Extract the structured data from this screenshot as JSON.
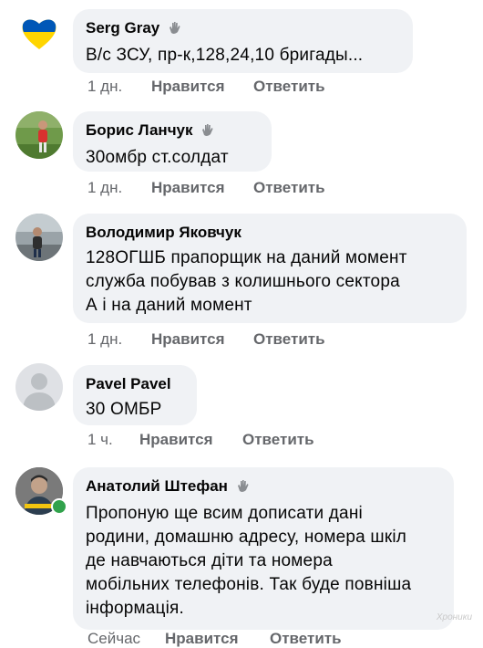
{
  "comments": [
    {
      "author": "Serg Gray",
      "text": "В/с ЗСУ, пр-к,128,24,10 бригады...",
      "time": "1 дн.",
      "like": "Нравится",
      "reply": "Ответить"
    },
    {
      "author": "Борис Ланчук",
      "text": "30омбр ст.солдат",
      "time": "1 дн.",
      "like": "Нравится",
      "reply": "Ответить"
    },
    {
      "author": "Володимир Яковчук",
      "text_lines": [
        "128ОГШБ прапорщик на даний момент",
        "служба побував з колишнього сектора",
        "А і на даний момент"
      ],
      "time": "1 дн.",
      "like": "Нравится",
      "reply": "Ответить"
    },
    {
      "author": "Pavel Pavel",
      "text": "30 ОМБР",
      "time": "1 ч.",
      "like": "Нравится",
      "reply": "Ответить"
    },
    {
      "author": "Анатолий Штефан",
      "text_lines": [
        "Пропоную ще всим дописати дані",
        "родини, домашню адресу, номера шкіл",
        "де навчаються діти та номера",
        "мобільних телефонів. Так буде повніша",
        "інформація."
      ],
      "time": "Сейчас",
      "like": "Нравится",
      "reply": "Ответить"
    }
  ],
  "watermark": "Хроники",
  "colors": {
    "bubble": "#f0f2f5",
    "meta": "#65676b",
    "online": "#31a24c"
  }
}
